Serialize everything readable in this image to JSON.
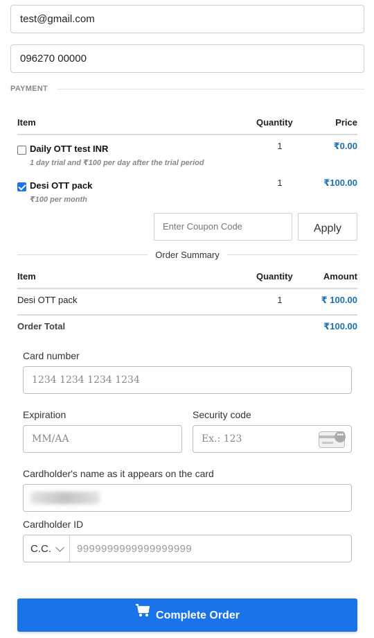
{
  "contact": {
    "email_value": "test@gmail.com",
    "phone_value": "096270 00000"
  },
  "payment": {
    "section_label": "PAYMENT",
    "table_headers": {
      "item": "Item",
      "quantity": "Quantity",
      "price": "Price"
    },
    "items": [
      {
        "name": "Daily OTT test INR",
        "subtitle": "1 day trial and ₹100 per day after the trial period",
        "quantity": "1",
        "price": "₹0.00",
        "checked": false
      },
      {
        "name": "Desi OTT pack",
        "subtitle": "₹100 per month",
        "quantity": "1",
        "price": "₹100.00",
        "checked": true
      }
    ],
    "coupon_placeholder": "Enter Coupon Code",
    "apply_label": "Apply"
  },
  "order_summary": {
    "title": "Order Summary",
    "headers": {
      "item": "Item",
      "quantity": "Quantity",
      "amount": "Amount"
    },
    "rows": [
      {
        "item": "Desi OTT pack",
        "quantity": "1",
        "amount": "₹ 100.00"
      }
    ],
    "total_label": "Order Total",
    "total_value": "₹100.00"
  },
  "card_form": {
    "card_number_label": "Card number",
    "card_number_placeholder": "1234 1234 1234 1234",
    "expiration_label": "Expiration",
    "expiration_placeholder": "MM/AA",
    "security_label": "Security code",
    "security_placeholder": "Ex.: 123",
    "cardholder_name_label": "Cardholder's name as it appears on the card",
    "cardholder_id_label": "Cardholder ID",
    "id_type_value": "C.C.",
    "id_number_placeholder": "9999999999999999999"
  },
  "complete_button_label": "Complete Order",
  "colors": {
    "accent": "#1a73e8",
    "price": "#1a6fb6"
  },
  "icons": {
    "cart": "shopping-cart-icon",
    "card": "credit-card-icon"
  }
}
